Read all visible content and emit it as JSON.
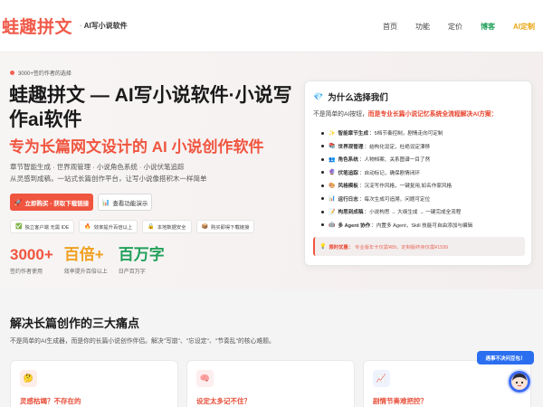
{
  "header": {
    "logo": "蛙趣拼文",
    "subtitle": "AI写小说软件",
    "nav": [
      "首页",
      "功能",
      "定价",
      "博客",
      "AI定制"
    ]
  },
  "hero": {
    "badge": "3000+签约作者的选择",
    "title": "蛙趣拼文 — AI写小说软件·小说写作ai软件",
    "subtitle": "专为长篇网文设计的 AI 小说创作软件",
    "desc_line1": "章节智能生成 · 世界观管理 · 小说角色系统 · 小说伏笔追踪",
    "desc_line2": "从灵感到成稿，一站式长篇创作平台，让写小说像搭积木一样简单",
    "primary_button": "立即购买 - 获取下载链接",
    "secondary_button": "查看功能演示",
    "tags": [
      {
        "icon": "check-icon",
        "label": "独立客户端 无需 IDE"
      },
      {
        "icon": "flame-icon",
        "label": "效率提升百倍以上"
      },
      {
        "icon": "lock-icon",
        "label": "本地数据安全"
      },
      {
        "icon": "box-icon",
        "label": "购买即得下载链接"
      }
    ],
    "stats": [
      {
        "value": "3000+",
        "label": "签约作者使用",
        "color": "#f0553f"
      },
      {
        "value": "百倍+",
        "label": "效率提升百倍以上",
        "color": "#f0a020"
      },
      {
        "value": "百万字",
        "label": "日产百万字",
        "color": "#22a05a"
      }
    ]
  },
  "card": {
    "title": "为什么选择我们",
    "intro_plain": "不是简单的AI按钮，",
    "intro_highlight": "而是专业长篇小说记忆系统全流程解决AI方案：",
    "features": [
      {
        "name": "智能章节生成",
        "text": "：5档节奏控制，剧情走向可定制"
      },
      {
        "name": "世界观管理",
        "text": "：结构化设定，杜绝设定漂移"
      },
      {
        "name": "角色系统",
        "text": "：人物档案、关系图谱一目了然"
      },
      {
        "name": "伏笔追踪",
        "text": "：自动标记，确保剧情闭环"
      },
      {
        "name": "风格模板",
        "text": "：沉淀写作风格，一键复用,如名作家风格"
      },
      {
        "name": "运行日志",
        "text": "：每次生成可追溯，问题可定位"
      },
      {
        "name": "构思到成稿",
        "text": "：小说构思 → 大纲生成 → 一键完成全流程"
      },
      {
        "name": "多 Agent 协作",
        "text": "：内置多 Agent，Skill 技能可自由添加与编辑"
      }
    ],
    "promo_label": "限时优惠：",
    "promo_text": "专业版年卡仅需¥89，定制版终身仅需¥1599"
  },
  "pain": {
    "title": "解决长篇创作的三大痛点",
    "subtitle": "不是简单的AI生成器，而是你的长篇小说创作伴侣。解决\"写崩\"、\"忘设定\"、\"节奏乱\"的核心难题。",
    "cards": [
      {
        "label": "灵感枯竭？不存在的",
        "color": "#e84f3a",
        "icon_bg": "#fdeee9"
      },
      {
        "label": "设定太多记不住？",
        "color": "#e84f3a",
        "icon_bg": "#fdeef0"
      },
      {
        "label": "剧情节奏难把控？",
        "color": "#e84f3a",
        "icon_bg": "#eef3fd"
      }
    ]
  },
  "floating": {
    "bubble": "遇事不决问豆包！"
  }
}
